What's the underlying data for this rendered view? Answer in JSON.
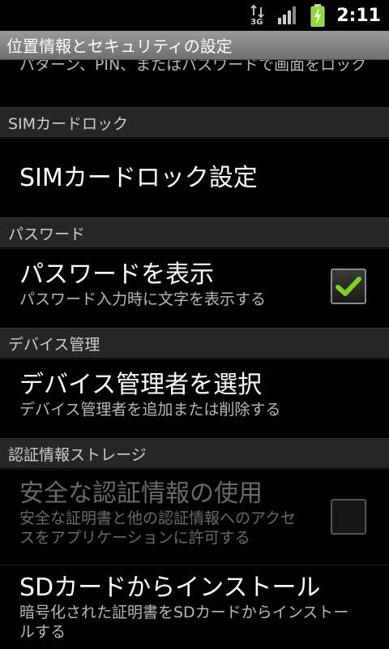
{
  "status_bar": {
    "network_type": "3G",
    "time": "2:11",
    "icons": [
      "data-transfer-icon",
      "signal-icon",
      "battery-charging-icon"
    ]
  },
  "title_bar": {
    "title": "位置情報とセキュリティの設定"
  },
  "partial_item": {
    "summary": "パターン、PIN、またはパスワードで画面をロック"
  },
  "sections": {
    "sim": {
      "header": "SIMカードロック",
      "items": [
        {
          "title": "SIMカードロック設定"
        }
      ]
    },
    "password": {
      "header": "パスワード",
      "items": [
        {
          "title": "パスワードを表示",
          "summary": "パスワード入力時に文字を表示する",
          "checked": true
        }
      ]
    },
    "device_admin": {
      "header": "デバイス管理",
      "items": [
        {
          "title": "デバイス管理者を選択",
          "summary": "デバイス管理者を追加または削除する"
        }
      ]
    },
    "credential_storage": {
      "header": "認証情報ストレージ",
      "items": [
        {
          "title": "安全な認証情報の使用",
          "summary": "安全な証明書と他の認証情報へのアクセスをアプリケーションに許可する",
          "checked": false,
          "enabled": false
        },
        {
          "title": "SDカードからインストール",
          "summary": "暗号化された証明書をSDカードからインストールする"
        }
      ]
    }
  },
  "colors": {
    "checkmark": "#7ed321",
    "battery_fill": "#8bdc2e",
    "category_bg": "#262626"
  }
}
